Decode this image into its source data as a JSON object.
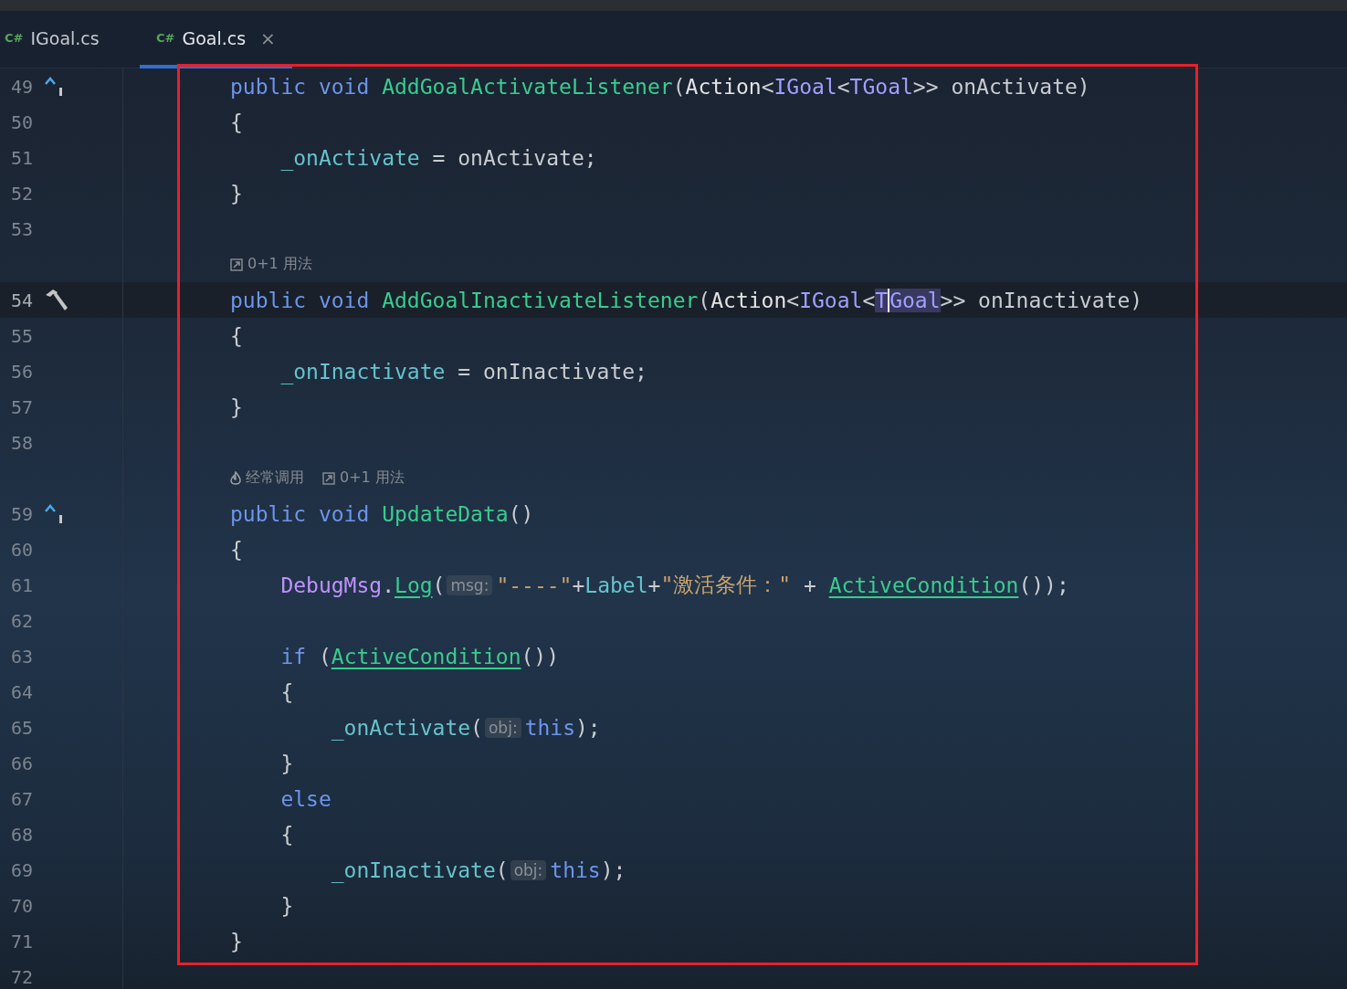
{
  "tabs": [
    {
      "lang": "C#",
      "label": "IGoal.cs",
      "selected": false
    },
    {
      "lang": "C#",
      "label": "Goal.cs",
      "selected": true,
      "close": "×"
    }
  ],
  "editor": {
    "rows": [
      {
        "kind": "code",
        "number": "49",
        "gutter": {
          "kind": "implements"
        },
        "tokens": [
          {
            "kind": "kw",
            "t": "public void "
          },
          {
            "kind": "method",
            "t": "AddGoalActivateListener"
          },
          {
            "kind": "plain",
            "t": "("
          },
          {
            "kind": "type",
            "t": "Action"
          },
          {
            "kind": "plain",
            "t": "<"
          },
          {
            "kind": "iface",
            "t": "IGoal"
          },
          {
            "kind": "plain",
            "t": "<"
          },
          {
            "kind": "iface",
            "t": "TGoal"
          },
          {
            "kind": "plain",
            "t": ">> onActivate)"
          }
        ]
      },
      {
        "kind": "code",
        "number": "50",
        "tokens": [
          {
            "kind": "plain",
            "t": "{"
          }
        ]
      },
      {
        "kind": "code",
        "number": "51",
        "tokens": [
          {
            "kind": "field",
            "t": "    _onActivate"
          },
          {
            "kind": "plain",
            "t": " = onActivate;"
          }
        ]
      },
      {
        "kind": "code",
        "number": "52",
        "tokens": [
          {
            "kind": "plain",
            "t": "}"
          }
        ]
      },
      {
        "kind": "code",
        "number": "53"
      },
      {
        "kind": "lens",
        "items": [
          {
            "kind": "usage",
            "text": "0+1 用法"
          }
        ]
      },
      {
        "kind": "code",
        "number": "54",
        "gutter": {
          "kind": "hammer"
        },
        "current": true,
        "tokens": [
          {
            "kind": "kw",
            "t": "public void "
          },
          {
            "kind": "method",
            "t": "AddGoalInactivateListener"
          },
          {
            "kind": "plain",
            "t": "("
          },
          {
            "kind": "type",
            "t": "Action"
          },
          {
            "kind": "plain",
            "t": "<"
          },
          {
            "kind": "iface",
            "t": "IGoal"
          },
          {
            "kind": "plain",
            "t": "<"
          },
          {
            "kind": "iface",
            "t": "T",
            "highlight": true
          },
          {
            "kind": "iface",
            "t": "Goal",
            "highlight": true,
            "caret": true
          },
          {
            "kind": "plain",
            "t": ">> onInactivate)"
          }
        ]
      },
      {
        "kind": "code",
        "number": "55",
        "tokens": [
          {
            "kind": "plain",
            "t": "{"
          }
        ]
      },
      {
        "kind": "code",
        "number": "56",
        "tokens": [
          {
            "kind": "field",
            "t": "    _onInactivate"
          },
          {
            "kind": "plain",
            "t": " = onInactivate;"
          }
        ]
      },
      {
        "kind": "code",
        "number": "57",
        "tokens": [
          {
            "kind": "plain",
            "t": "}"
          }
        ]
      },
      {
        "kind": "code",
        "number": "58"
      },
      {
        "kind": "lens",
        "items": [
          {
            "kind": "flame",
            "text": "经常调用"
          },
          {
            "kind": "usage",
            "text": "0+1 用法"
          }
        ]
      },
      {
        "kind": "code",
        "number": "59",
        "gutter": {
          "kind": "implements"
        },
        "tokens": [
          {
            "kind": "kw",
            "t": "public void "
          },
          {
            "kind": "method",
            "t": "UpdateData"
          },
          {
            "kind": "plain",
            "t": "()"
          }
        ]
      },
      {
        "kind": "code",
        "number": "60",
        "tokens": [
          {
            "kind": "plain",
            "t": "{"
          }
        ]
      },
      {
        "kind": "code",
        "number": "61",
        "tokens": [
          {
            "kind": "class",
            "t": "    DebugMsg"
          },
          {
            "kind": "plain",
            "t": "."
          },
          {
            "kind": "method",
            "t": "Log",
            "underline": true
          },
          {
            "kind": "plain",
            "t": "("
          },
          {
            "kind": "hint",
            "t": "msg:"
          },
          {
            "kind": "string",
            "t": "\"----\""
          },
          {
            "kind": "plain",
            "t": "+"
          },
          {
            "kind": "field",
            "t": "Label"
          },
          {
            "kind": "plain",
            "t": "+"
          },
          {
            "kind": "string",
            "t": "\"激活条件：\""
          },
          {
            "kind": "plain",
            "t": " + "
          },
          {
            "kind": "method",
            "t": "ActiveCondition",
            "underline": true
          },
          {
            "kind": "plain",
            "t": "());"
          }
        ]
      },
      {
        "kind": "code",
        "number": "62"
      },
      {
        "kind": "code",
        "number": "63",
        "tokens": [
          {
            "kind": "kw",
            "t": "    if"
          },
          {
            "kind": "plain",
            "t": " ("
          },
          {
            "kind": "method",
            "t": "ActiveCondition",
            "underline": true
          },
          {
            "kind": "plain",
            "t": "())"
          }
        ]
      },
      {
        "kind": "code",
        "number": "64",
        "tokens": [
          {
            "kind": "plain",
            "t": "    {"
          }
        ]
      },
      {
        "kind": "code",
        "number": "65",
        "tokens": [
          {
            "kind": "field",
            "t": "        _onActivate"
          },
          {
            "kind": "plain",
            "t": "("
          },
          {
            "kind": "hint",
            "t": "obj:"
          },
          {
            "kind": "kw",
            "t": "this"
          },
          {
            "kind": "plain",
            "t": ");"
          }
        ]
      },
      {
        "kind": "code",
        "number": "66",
        "tokens": [
          {
            "kind": "plain",
            "t": "    }"
          }
        ]
      },
      {
        "kind": "code",
        "number": "67",
        "tokens": [
          {
            "kind": "kw",
            "t": "    else"
          }
        ]
      },
      {
        "kind": "code",
        "number": "68",
        "tokens": [
          {
            "kind": "plain",
            "t": "    {"
          }
        ]
      },
      {
        "kind": "code",
        "number": "69",
        "tokens": [
          {
            "kind": "field",
            "t": "        _onInactivate"
          },
          {
            "kind": "plain",
            "t": "("
          },
          {
            "kind": "hint",
            "t": "obj:"
          },
          {
            "kind": "kw",
            "t": "this"
          },
          {
            "kind": "plain",
            "t": ");"
          }
        ]
      },
      {
        "kind": "code",
        "number": "70",
        "tokens": [
          {
            "kind": "plain",
            "t": "    }"
          }
        ]
      },
      {
        "kind": "code",
        "number": "71",
        "tokens": [
          {
            "kind": "plain",
            "t": "}"
          }
        ]
      },
      {
        "kind": "code",
        "number": "72"
      }
    ]
  }
}
